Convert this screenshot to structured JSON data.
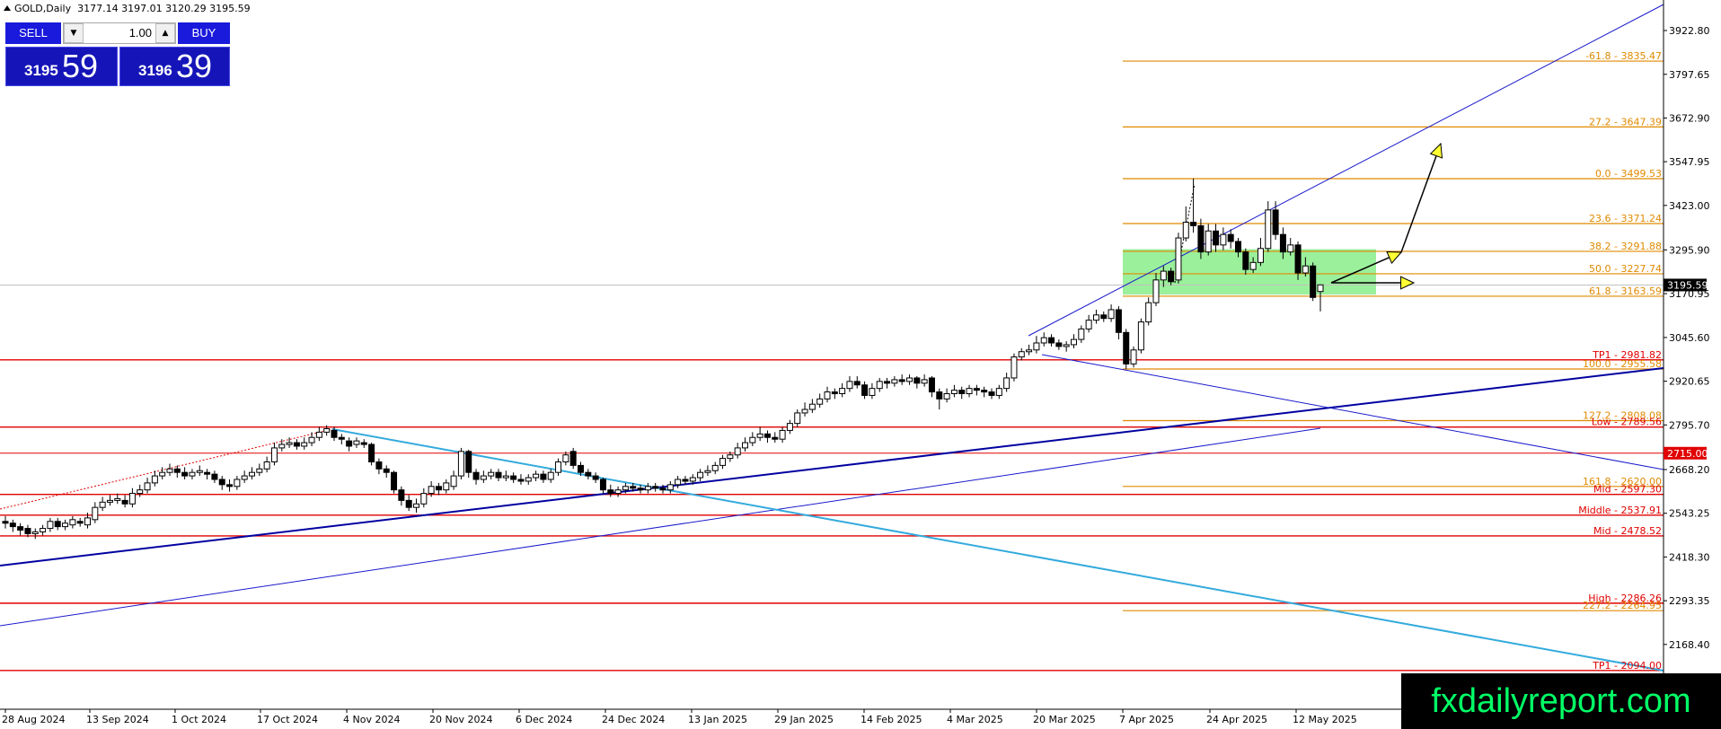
{
  "header": {
    "symbol": "GOLD,Daily",
    "ohlc": "3177.14 3197.01 3120.29 3195.59"
  },
  "trade_panel": {
    "sell_label": "SELL",
    "buy_label": "BUY",
    "volume": "1.00",
    "sell_price_small": "3195",
    "sell_price_big": "59",
    "buy_price_small": "3196",
    "buy_price_big": "39"
  },
  "brand": "fxdailyreport.com",
  "chart_data": {
    "type": "candlestick",
    "symbol": "GOLD",
    "timeframe": "Daily",
    "ylim": [
      2100,
      3950
    ],
    "y_ticks": [
      "3922.80",
      "3797.65",
      "3672.90",
      "3547.95",
      "3423.00",
      "3295.90",
      "3170.95",
      "3045.60",
      "2920.65",
      "2795.70",
      "2668.20",
      "2543.25",
      "2418.30",
      "2293.35",
      "2168.40"
    ],
    "x_ticks": [
      "28 Aug 2024",
      "13 Sep 2024",
      "1 Oct 2024",
      "17 Oct 2024",
      "4 Nov 2024",
      "20 Nov 2024",
      "6 Dec 2024",
      "24 Dec 2024",
      "13 Jan 2025",
      "29 Jan 2025",
      "14 Feb 2025",
      "4 Mar 2025",
      "20 Mar 2025",
      "7 Apr 2025",
      "24 Apr 2025",
      "12 May 2025"
    ],
    "current_price": "3195.59",
    "fibonacci_levels": [
      {
        "label": "-61.8 - 3835.47",
        "price": 3835.47
      },
      {
        "label": "27.2 - 3647.39",
        "price": 3647.39
      },
      {
        "label": "0.0 - 3499.53",
        "price": 3499.53
      },
      {
        "label": "23.6 - 3371.24",
        "price": 3371.24
      },
      {
        "label": "38.2 - 3291.88",
        "price": 3291.88
      },
      {
        "label": "50.0 - 3227.74",
        "price": 3227.74
      },
      {
        "label": "61.8 - 3163.59",
        "price": 3163.59
      },
      {
        "label": "100.0 - 2955.58",
        "price": 2955.58
      },
      {
        "label": "127.2 - 2808.08",
        "price": 2808.08
      },
      {
        "label": "161.8 - 2620.00",
        "price": 2620.0
      },
      {
        "label": "227.2 - 2264.95",
        "price": 2264.95
      }
    ],
    "levels": [
      {
        "label": "TP1 - 2981.82",
        "price": 2981.82
      },
      {
        "label": "Low - 2789.56",
        "price": 2789.56
      },
      {
        "label": "Mid - 2597.30",
        "price": 2597.3
      },
      {
        "label": "Middle - 2537.91",
        "price": 2537.91
      },
      {
        "label": "Mid - 2478.52",
        "price": 2478.52
      },
      {
        "label": "High - 2286.26",
        "price": 2286.26
      },
      {
        "label": "TP1 - 2094.00",
        "price": 2094.0
      }
    ],
    "marked_level": {
      "label": "2715.00",
      "price": 2715.0
    },
    "candles": [
      [
        2520,
        2515,
        2535,
        2500
      ],
      [
        2515,
        2505,
        2525,
        2490
      ],
      [
        2505,
        2495,
        2515,
        2480
      ],
      [
        2500,
        2485,
        2510,
        2475
      ],
      [
        2485,
        2490,
        2500,
        2470
      ],
      [
        2490,
        2500,
        2510,
        2480
      ],
      [
        2500,
        2520,
        2530,
        2490
      ],
      [
        2520,
        2505,
        2530,
        2495
      ],
      [
        2505,
        2515,
        2525,
        2495
      ],
      [
        2510,
        2525,
        2535,
        2500
      ],
      [
        2520,
        2515,
        2530,
        2505
      ],
      [
        2510,
        2530,
        2545,
        2500
      ],
      [
        2525,
        2560,
        2575,
        2515
      ],
      [
        2560,
        2575,
        2590,
        2550
      ],
      [
        2575,
        2580,
        2595,
        2565
      ],
      [
        2580,
        2585,
        2600,
        2570
      ],
      [
        2580,
        2570,
        2595,
        2560
      ],
      [
        2570,
        2600,
        2615,
        2560
      ],
      [
        2600,
        2610,
        2625,
        2590
      ],
      [
        2610,
        2630,
        2645,
        2600
      ],
      [
        2630,
        2650,
        2665,
        2620
      ],
      [
        2650,
        2660,
        2675,
        2640
      ],
      [
        2660,
        2670,
        2685,
        2650
      ],
      [
        2670,
        2660,
        2680,
        2645
      ],
      [
        2660,
        2650,
        2675,
        2640
      ],
      [
        2650,
        2660,
        2670,
        2640
      ],
      [
        2660,
        2665,
        2680,
        2650
      ],
      [
        2660,
        2655,
        2670,
        2640
      ],
      [
        2655,
        2640,
        2665,
        2630
      ],
      [
        2640,
        2625,
        2650,
        2610
      ],
      [
        2625,
        2620,
        2640,
        2605
      ],
      [
        2620,
        2640,
        2650,
        2610
      ],
      [
        2640,
        2650,
        2665,
        2630
      ],
      [
        2650,
        2660,
        2675,
        2640
      ],
      [
        2660,
        2670,
        2685,
        2650
      ],
      [
        2670,
        2690,
        2705,
        2660
      ],
      [
        2690,
        2730,
        2745,
        2680
      ],
      [
        2730,
        2740,
        2755,
        2720
      ],
      [
        2740,
        2745,
        2760,
        2730
      ],
      [
        2745,
        2735,
        2755,
        2725
      ],
      [
        2735,
        2745,
        2760,
        2725
      ],
      [
        2745,
        2760,
        2775,
        2735
      ],
      [
        2760,
        2775,
        2790,
        2750
      ],
      [
        2775,
        2785,
        2795,
        2765
      ],
      [
        2780,
        2760,
        2790,
        2750
      ],
      [
        2760,
        2755,
        2770,
        2740
      ],
      [
        2750,
        2735,
        2760,
        2720
      ],
      [
        2740,
        2750,
        2760,
        2730
      ],
      [
        2745,
        2740,
        2755,
        2730
      ],
      [
        2740,
        2690,
        2745,
        2680
      ],
      [
        2690,
        2670,
        2700,
        2655
      ],
      [
        2670,
        2660,
        2680,
        2645
      ],
      [
        2660,
        2610,
        2665,
        2600
      ],
      [
        2610,
        2580,
        2620,
        2565
      ],
      [
        2580,
        2560,
        2595,
        2550
      ],
      [
        2560,
        2570,
        2585,
        2545
      ],
      [
        2570,
        2600,
        2615,
        2560
      ],
      [
        2600,
        2620,
        2635,
        2590
      ],
      [
        2620,
        2610,
        2630,
        2595
      ],
      [
        2610,
        2630,
        2640,
        2600
      ],
      [
        2620,
        2650,
        2665,
        2610
      ],
      [
        2650,
        2720,
        2730,
        2640
      ],
      [
        2720,
        2660,
        2725,
        2645
      ],
      [
        2660,
        2640,
        2670,
        2625
      ],
      [
        2640,
        2650,
        2665,
        2630
      ],
      [
        2650,
        2660,
        2670,
        2640
      ],
      [
        2660,
        2645,
        2670,
        2635
      ],
      [
        2645,
        2650,
        2665,
        2635
      ],
      [
        2650,
        2640,
        2660,
        2630
      ],
      [
        2640,
        2635,
        2655,
        2625
      ],
      [
        2635,
        2645,
        2655,
        2625
      ],
      [
        2645,
        2655,
        2665,
        2635
      ],
      [
        2655,
        2640,
        2665,
        2630
      ],
      [
        2640,
        2660,
        2670,
        2630
      ],
      [
        2660,
        2690,
        2700,
        2650
      ],
      [
        2690,
        2710,
        2720,
        2680
      ],
      [
        2720,
        2680,
        2730,
        2670
      ],
      [
        2680,
        2660,
        2690,
        2650
      ],
      [
        2660,
        2650,
        2670,
        2640
      ],
      [
        2650,
        2640,
        2660,
        2630
      ],
      [
        2640,
        2610,
        2645,
        2600
      ],
      [
        2610,
        2600,
        2625,
        2590
      ],
      [
        2600,
        2610,
        2620,
        2590
      ],
      [
        2610,
        2620,
        2630,
        2600
      ],
      [
        2620,
        2615,
        2630,
        2605
      ],
      [
        2615,
        2610,
        2625,
        2600
      ],
      [
        2610,
        2620,
        2630,
        2600
      ],
      [
        2620,
        2615,
        2630,
        2605
      ],
      [
        2615,
        2610,
        2625,
        2600
      ],
      [
        2610,
        2625,
        2635,
        2600
      ],
      [
        2625,
        2640,
        2650,
        2615
      ],
      [
        2640,
        2635,
        2650,
        2625
      ],
      [
        2635,
        2645,
        2655,
        2625
      ],
      [
        2645,
        2660,
        2670,
        2635
      ],
      [
        2660,
        2665,
        2680,
        2650
      ],
      [
        2665,
        2680,
        2690,
        2655
      ],
      [
        2680,
        2700,
        2710,
        2670
      ],
      [
        2700,
        2710,
        2720,
        2690
      ],
      [
        2710,
        2730,
        2745,
        2700
      ],
      [
        2730,
        2745,
        2760,
        2720
      ],
      [
        2745,
        2760,
        2775,
        2735
      ],
      [
        2760,
        2770,
        2790,
        2750
      ],
      [
        2770,
        2760,
        2780,
        2745
      ],
      [
        2760,
        2755,
        2775,
        2745
      ],
      [
        2755,
        2780,
        2790,
        2745
      ],
      [
        2780,
        2800,
        2810,
        2770
      ],
      [
        2800,
        2830,
        2840,
        2790
      ],
      [
        2830,
        2840,
        2860,
        2820
      ],
      [
        2840,
        2855,
        2870,
        2830
      ],
      [
        2855,
        2870,
        2885,
        2845
      ],
      [
        2870,
        2890,
        2905,
        2860
      ],
      [
        2890,
        2885,
        2900,
        2870
      ],
      [
        2885,
        2900,
        2915,
        2875
      ],
      [
        2900,
        2920,
        2935,
        2890
      ],
      [
        2920,
        2910,
        2935,
        2900
      ],
      [
        2910,
        2880,
        2920,
        2870
      ],
      [
        2880,
        2900,
        2915,
        2870
      ],
      [
        2900,
        2920,
        2930,
        2890
      ],
      [
        2920,
        2915,
        2930,
        2900
      ],
      [
        2915,
        2925,
        2935,
        2905
      ],
      [
        2925,
        2920,
        2940,
        2910
      ],
      [
        2920,
        2930,
        2940,
        2910
      ],
      [
        2930,
        2915,
        2935,
        2900
      ],
      [
        2915,
        2925,
        2940,
        2905
      ],
      [
        2930,
        2890,
        2935,
        2875
      ],
      [
        2890,
        2870,
        2900,
        2840
      ],
      [
        2870,
        2885,
        2900,
        2860
      ],
      [
        2885,
        2895,
        2910,
        2875
      ],
      [
        2895,
        2885,
        2905,
        2870
      ],
      [
        2885,
        2900,
        2910,
        2875
      ],
      [
        2900,
        2895,
        2910,
        2880
      ],
      [
        2895,
        2890,
        2905,
        2875
      ],
      [
        2890,
        2880,
        2900,
        2870
      ],
      [
        2880,
        2900,
        2910,
        2870
      ],
      [
        2900,
        2930,
        2945,
        2890
      ],
      [
        2930,
        2990,
        3000,
        2920
      ],
      [
        2990,
        3005,
        3015,
        2980
      ],
      [
        3005,
        3010,
        3025,
        2995
      ],
      [
        3010,
        3030,
        3050,
        3000
      ],
      [
        3030,
        3045,
        3060,
        3020
      ],
      [
        3045,
        3030,
        3055,
        3020
      ],
      [
        3030,
        3020,
        3040,
        3010
      ],
      [
        3020,
        3025,
        3035,
        3005
      ],
      [
        3025,
        3040,
        3055,
        3015
      ],
      [
        3040,
        3070,
        3080,
        3030
      ],
      [
        3070,
        3095,
        3110,
        3060
      ],
      [
        3095,
        3110,
        3125,
        3085
      ],
      [
        3110,
        3100,
        3120,
        3090
      ],
      [
        3100,
        3125,
        3140,
        3090
      ],
      [
        3125,
        3060,
        3135,
        3040
      ],
      [
        3060,
        2970,
        3070,
        2955
      ],
      [
        2970,
        3010,
        3020,
        2960
      ],
      [
        3010,
        3090,
        3100,
        3000
      ],
      [
        3090,
        3145,
        3160,
        3080
      ],
      [
        3145,
        3210,
        3230,
        3135
      ],
      [
        3210,
        3235,
        3250,
        3190
      ],
      [
        3235,
        3205,
        3245,
        3195
      ],
      [
        3210,
        3330,
        3345,
        3200
      ],
      [
        3330,
        3375,
        3420,
        3320
      ],
      [
        3375,
        3365,
        3500,
        3345
      ],
      [
        3365,
        3290,
        3385,
        3270
      ],
      [
        3290,
        3350,
        3370,
        3280
      ],
      [
        3350,
        3310,
        3370,
        3290
      ],
      [
        3310,
        3340,
        3360,
        3295
      ],
      [
        3340,
        3320,
        3355,
        3300
      ],
      [
        3320,
        3290,
        3330,
        3275
      ],
      [
        3290,
        3240,
        3300,
        3225
      ],
      [
        3240,
        3260,
        3275,
        3230
      ],
      [
        3260,
        3300,
        3330,
        3250
      ],
      [
        3300,
        3410,
        3435,
        3290
      ],
      [
        3410,
        3340,
        3435,
        3325
      ],
      [
        3340,
        3290,
        3360,
        3270
      ],
      [
        3290,
        3310,
        3330,
        3280
      ],
      [
        3310,
        3230,
        3320,
        3210
      ],
      [
        3230,
        3250,
        3275,
        3220
      ],
      [
        3250,
        3160,
        3260,
        3150
      ],
      [
        3177,
        3196,
        3197,
        3120
      ]
    ],
    "annotations": [
      "trend channel",
      "projection arrows",
      "support zone"
    ]
  }
}
